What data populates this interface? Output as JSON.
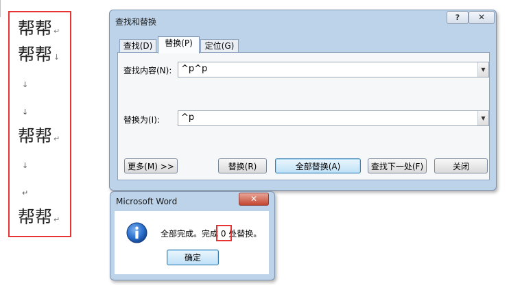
{
  "document": {
    "lines": [
      {
        "text": "帮帮",
        "mark": "↵"
      },
      {
        "text": "帮帮",
        "mark": "↓"
      },
      {
        "text": "",
        "mark": "↓"
      },
      {
        "text": "",
        "mark": "↓"
      },
      {
        "text": "帮帮",
        "mark": "↵"
      },
      {
        "text": "",
        "mark": "↓"
      },
      {
        "text": "",
        "mark": "↵"
      },
      {
        "text": "帮帮",
        "mark": "↵"
      }
    ]
  },
  "find_replace_dialog": {
    "title": "查找和替换",
    "help_label": "?",
    "close_label": "✕",
    "tabs": [
      {
        "label": "查找(D)"
      },
      {
        "label": "替换(P)"
      },
      {
        "label": "定位(G)"
      }
    ],
    "find_label": "查找内容(N):",
    "find_value": "^p^p",
    "replace_label": "替换为(I):",
    "replace_value": "^p",
    "buttons": {
      "more": "更多(M) >>",
      "replace": "替换(R)",
      "replace_all": "全部替换(A)",
      "find_next": "查找下一处(F)",
      "close": "关闭"
    }
  },
  "message_box": {
    "title": "Microsoft Word",
    "close_label": "✕",
    "message": "全部完成。完成 0 处替换。",
    "ok_label": "确定"
  },
  "colors": {
    "highlight": "#e63333",
    "dialog_frame": "#bcd3ea",
    "info_icon": "#1f5fb8"
  },
  "icons": {
    "info": "info-icon",
    "dropdown": "chevron-down-icon"
  }
}
